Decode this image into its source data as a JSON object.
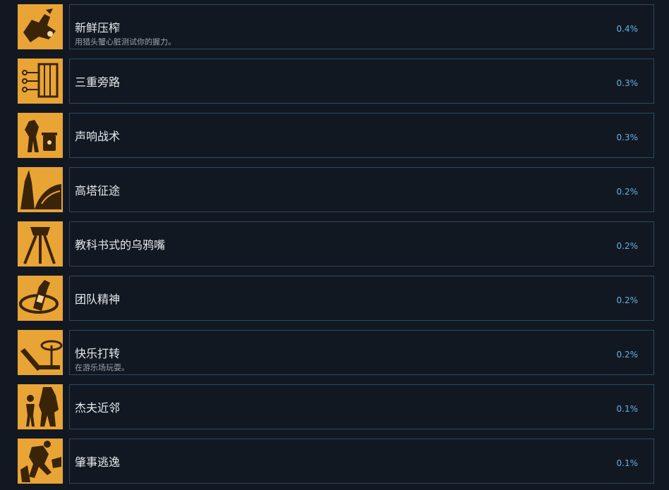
{
  "colors": {
    "background": "#121821",
    "card_border": "#2a4a63",
    "title_text": "#e6e9ec",
    "desc_text": "#9aa3ad",
    "percent_text": "#61b3e8",
    "icon_gold": "#e9a436",
    "icon_dark": "#3a2408"
  },
  "achievements": [
    {
      "icon": "headcrab-heart-icon",
      "title": "新鲜压榨",
      "desc": "用猎头蟹心脏测试你的握力。",
      "percent": "0.4%"
    },
    {
      "icon": "circuit-panel-icon",
      "title": "三重旁路",
      "desc": "",
      "percent": "0.3%"
    },
    {
      "icon": "zombie-trashcan-icon",
      "title": "声响战术",
      "desc": "",
      "percent": "0.3%"
    },
    {
      "icon": "tower-icon",
      "title": "高塔征途",
      "desc": "",
      "percent": "0.2%"
    },
    {
      "icon": "strider-icon",
      "title": "教科书式的乌鸦嘴",
      "desc": "",
      "percent": "0.2%"
    },
    {
      "icon": "bottle-icon",
      "title": "团队精神",
      "desc": "",
      "percent": "0.2%"
    },
    {
      "icon": "playground-slide-icon",
      "title": "快乐打转",
      "desc": "在游乐场玩耍。",
      "percent": "0.2%"
    },
    {
      "icon": "neighbors-icon",
      "title": "杰夫近邻",
      "desc": "",
      "percent": "0.1%"
    },
    {
      "icon": "escape-icon",
      "title": "肇事逃逸",
      "desc": "",
      "percent": "0.1%"
    }
  ]
}
